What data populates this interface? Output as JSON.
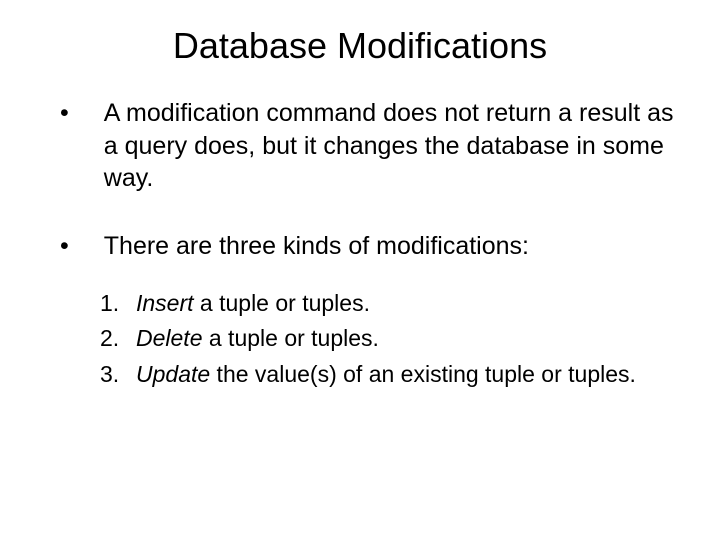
{
  "title": "Database Modifications",
  "bullets": [
    {
      "text": "A modification command does not return a result as a query does, but it changes the database in some way."
    },
    {
      "text": "There are three kinds of modifications:"
    }
  ],
  "numbered": [
    {
      "num": "1.",
      "emphasis": "Insert",
      "rest": "  a tuple or tuples."
    },
    {
      "num": "2.",
      "emphasis": "Delete",
      "rest": "  a tuple or tuples."
    },
    {
      "num": "3.",
      "emphasis": "Update",
      "rest": "  the value(s) of an existing tuple or tuples."
    }
  ]
}
